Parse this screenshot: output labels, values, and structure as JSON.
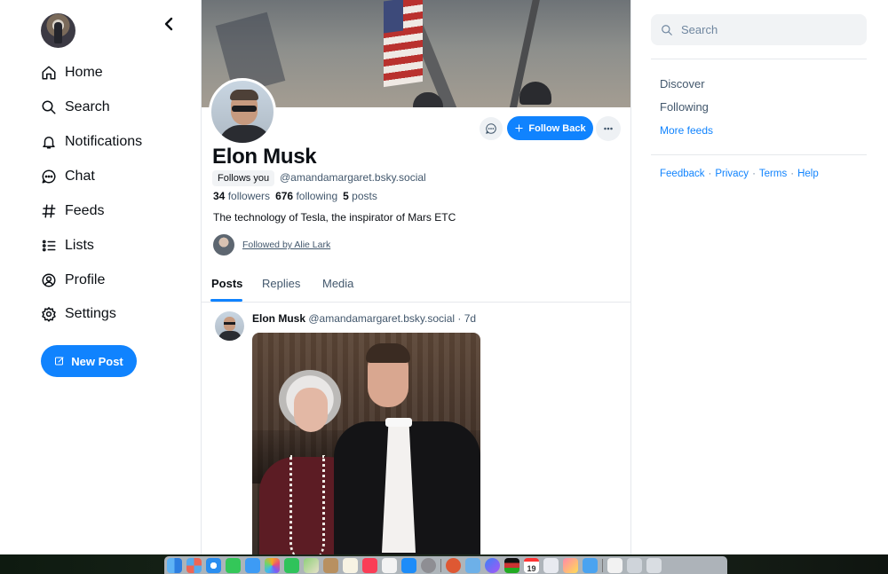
{
  "nav": {
    "items": [
      {
        "label": "Home",
        "icon": "home-icon"
      },
      {
        "label": "Search",
        "icon": "search-icon"
      },
      {
        "label": "Notifications",
        "icon": "bell-icon"
      },
      {
        "label": "Chat",
        "icon": "chat-icon"
      },
      {
        "label": "Feeds",
        "icon": "hash-icon"
      },
      {
        "label": "Lists",
        "icon": "list-icon"
      },
      {
        "label": "Profile",
        "icon": "user-circle-icon"
      },
      {
        "label": "Settings",
        "icon": "gear-icon"
      }
    ],
    "new_post": "New Post"
  },
  "profile": {
    "display_name": "Elon Musk",
    "follows_you": "Follows you",
    "handle": "@amandamargaret.bsky.social",
    "followers_count": "34",
    "followers_label": "followers",
    "following_count": "676",
    "following_label": "following",
    "posts_count": "5",
    "posts_label": "posts",
    "bio": "The technology of Tesla, the inspirator of Mars ETC",
    "followed_by": "Followed by Alie Lark",
    "follow_back": "Follow Back"
  },
  "tabs": [
    "Posts",
    "Replies",
    "Media"
  ],
  "post": {
    "author": "Elon Musk",
    "handle": "@amandamargaret.bsky.social",
    "time": "· 7d"
  },
  "right": {
    "search_placeholder": "Search",
    "feeds": [
      "Discover",
      "Following",
      "More feeds"
    ],
    "footer": [
      "Feedback",
      "Privacy",
      "Terms",
      "Help"
    ]
  },
  "colors": {
    "accent": "#1083fe",
    "muted": "#42576c",
    "text": "#0b0f14"
  },
  "dock": {
    "apps": [
      "finder-icon",
      "launchpad-icon",
      "safari-icon",
      "messages-icon",
      "mail-icon",
      "photos-icon",
      "facetime-icon",
      "maps-icon",
      "notes-app-icon",
      "reminders-icon",
      "music-icon",
      "news-icon",
      "app-store-icon",
      "settings-app-icon",
      "duckduckgo-icon",
      "preview-icon",
      "messenger-icon",
      "flag-app-icon",
      "calendar-icon",
      "drive-icon",
      "game-app-icon",
      "photo-app-icon",
      "screenshot-icon",
      "folder-icon",
      "trash-icon"
    ],
    "calendar_day": "19"
  }
}
